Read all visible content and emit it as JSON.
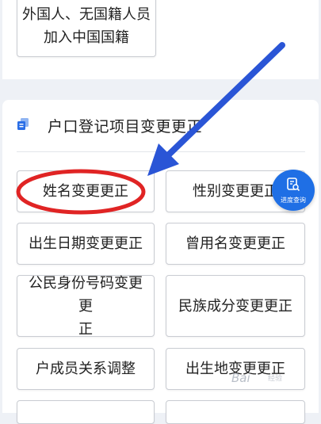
{
  "top_card": {
    "items": [
      {
        "label_line1": "外国人、无国籍人员",
        "label_line2": "加入中国国籍"
      }
    ]
  },
  "section": {
    "title": "户口登记项目变更更正",
    "icon": "document-stack-icon",
    "items": [
      {
        "label": "姓名变更更正"
      },
      {
        "label": "性别变更更正"
      },
      {
        "label": "出生日期变更更正"
      },
      {
        "label": "曾用名变更更正"
      },
      {
        "label_line1": "公民身份号码变更更",
        "label_line2": "正"
      },
      {
        "label": "民族成分变更更正"
      },
      {
        "label": "户成员关系调整"
      },
      {
        "label": "出生地变更更正"
      }
    ]
  },
  "progress_button": {
    "label": "进度查询",
    "icon": "progress-query-icon"
  },
  "watermark": {
    "text": "Bai",
    "sub": "经验"
  },
  "colors": {
    "accent": "#1f6fe5",
    "annotation_arrow": "#2a55d6",
    "annotation_circle": "#e02424"
  }
}
